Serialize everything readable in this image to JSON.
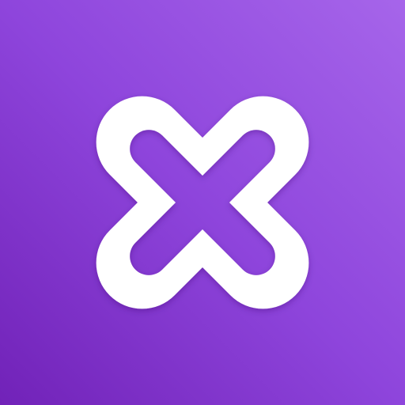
{
  "icon": {
    "name": "interlocked-loops-x-logo",
    "symbol_color": "#ffffff",
    "background_top_right": "#a665ea",
    "background_center": "#8e45dc",
    "background_bottom_left": "#7122b8"
  }
}
